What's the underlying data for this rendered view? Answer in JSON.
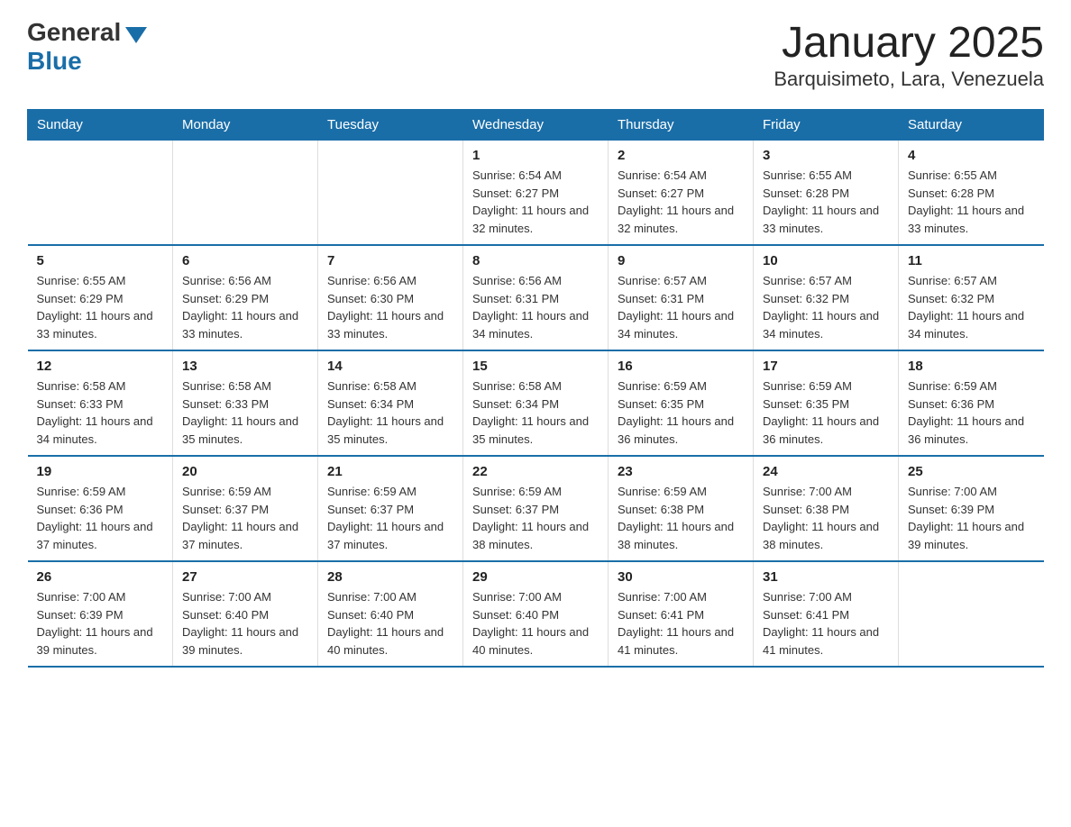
{
  "logo": {
    "general": "General",
    "blue": "Blue"
  },
  "title": "January 2025",
  "subtitle": "Barquisimeto, Lara, Venezuela",
  "days_of_week": [
    "Sunday",
    "Monday",
    "Tuesday",
    "Wednesday",
    "Thursday",
    "Friday",
    "Saturday"
  ],
  "weeks": [
    [
      {
        "day": "",
        "info": ""
      },
      {
        "day": "",
        "info": ""
      },
      {
        "day": "",
        "info": ""
      },
      {
        "day": "1",
        "info": "Sunrise: 6:54 AM\nSunset: 6:27 PM\nDaylight: 11 hours and 32 minutes."
      },
      {
        "day": "2",
        "info": "Sunrise: 6:54 AM\nSunset: 6:27 PM\nDaylight: 11 hours and 32 minutes."
      },
      {
        "day": "3",
        "info": "Sunrise: 6:55 AM\nSunset: 6:28 PM\nDaylight: 11 hours and 33 minutes."
      },
      {
        "day": "4",
        "info": "Sunrise: 6:55 AM\nSunset: 6:28 PM\nDaylight: 11 hours and 33 minutes."
      }
    ],
    [
      {
        "day": "5",
        "info": "Sunrise: 6:55 AM\nSunset: 6:29 PM\nDaylight: 11 hours and 33 minutes."
      },
      {
        "day": "6",
        "info": "Sunrise: 6:56 AM\nSunset: 6:29 PM\nDaylight: 11 hours and 33 minutes."
      },
      {
        "day": "7",
        "info": "Sunrise: 6:56 AM\nSunset: 6:30 PM\nDaylight: 11 hours and 33 minutes."
      },
      {
        "day": "8",
        "info": "Sunrise: 6:56 AM\nSunset: 6:31 PM\nDaylight: 11 hours and 34 minutes."
      },
      {
        "day": "9",
        "info": "Sunrise: 6:57 AM\nSunset: 6:31 PM\nDaylight: 11 hours and 34 minutes."
      },
      {
        "day": "10",
        "info": "Sunrise: 6:57 AM\nSunset: 6:32 PM\nDaylight: 11 hours and 34 minutes."
      },
      {
        "day": "11",
        "info": "Sunrise: 6:57 AM\nSunset: 6:32 PM\nDaylight: 11 hours and 34 minutes."
      }
    ],
    [
      {
        "day": "12",
        "info": "Sunrise: 6:58 AM\nSunset: 6:33 PM\nDaylight: 11 hours and 34 minutes."
      },
      {
        "day": "13",
        "info": "Sunrise: 6:58 AM\nSunset: 6:33 PM\nDaylight: 11 hours and 35 minutes."
      },
      {
        "day": "14",
        "info": "Sunrise: 6:58 AM\nSunset: 6:34 PM\nDaylight: 11 hours and 35 minutes."
      },
      {
        "day": "15",
        "info": "Sunrise: 6:58 AM\nSunset: 6:34 PM\nDaylight: 11 hours and 35 minutes."
      },
      {
        "day": "16",
        "info": "Sunrise: 6:59 AM\nSunset: 6:35 PM\nDaylight: 11 hours and 36 minutes."
      },
      {
        "day": "17",
        "info": "Sunrise: 6:59 AM\nSunset: 6:35 PM\nDaylight: 11 hours and 36 minutes."
      },
      {
        "day": "18",
        "info": "Sunrise: 6:59 AM\nSunset: 6:36 PM\nDaylight: 11 hours and 36 minutes."
      }
    ],
    [
      {
        "day": "19",
        "info": "Sunrise: 6:59 AM\nSunset: 6:36 PM\nDaylight: 11 hours and 37 minutes."
      },
      {
        "day": "20",
        "info": "Sunrise: 6:59 AM\nSunset: 6:37 PM\nDaylight: 11 hours and 37 minutes."
      },
      {
        "day": "21",
        "info": "Sunrise: 6:59 AM\nSunset: 6:37 PM\nDaylight: 11 hours and 37 minutes."
      },
      {
        "day": "22",
        "info": "Sunrise: 6:59 AM\nSunset: 6:37 PM\nDaylight: 11 hours and 38 minutes."
      },
      {
        "day": "23",
        "info": "Sunrise: 6:59 AM\nSunset: 6:38 PM\nDaylight: 11 hours and 38 minutes."
      },
      {
        "day": "24",
        "info": "Sunrise: 7:00 AM\nSunset: 6:38 PM\nDaylight: 11 hours and 38 minutes."
      },
      {
        "day": "25",
        "info": "Sunrise: 7:00 AM\nSunset: 6:39 PM\nDaylight: 11 hours and 39 minutes."
      }
    ],
    [
      {
        "day": "26",
        "info": "Sunrise: 7:00 AM\nSunset: 6:39 PM\nDaylight: 11 hours and 39 minutes."
      },
      {
        "day": "27",
        "info": "Sunrise: 7:00 AM\nSunset: 6:40 PM\nDaylight: 11 hours and 39 minutes."
      },
      {
        "day": "28",
        "info": "Sunrise: 7:00 AM\nSunset: 6:40 PM\nDaylight: 11 hours and 40 minutes."
      },
      {
        "day": "29",
        "info": "Sunrise: 7:00 AM\nSunset: 6:40 PM\nDaylight: 11 hours and 40 minutes."
      },
      {
        "day": "30",
        "info": "Sunrise: 7:00 AM\nSunset: 6:41 PM\nDaylight: 11 hours and 41 minutes."
      },
      {
        "day": "31",
        "info": "Sunrise: 7:00 AM\nSunset: 6:41 PM\nDaylight: 11 hours and 41 minutes."
      },
      {
        "day": "",
        "info": ""
      }
    ]
  ]
}
